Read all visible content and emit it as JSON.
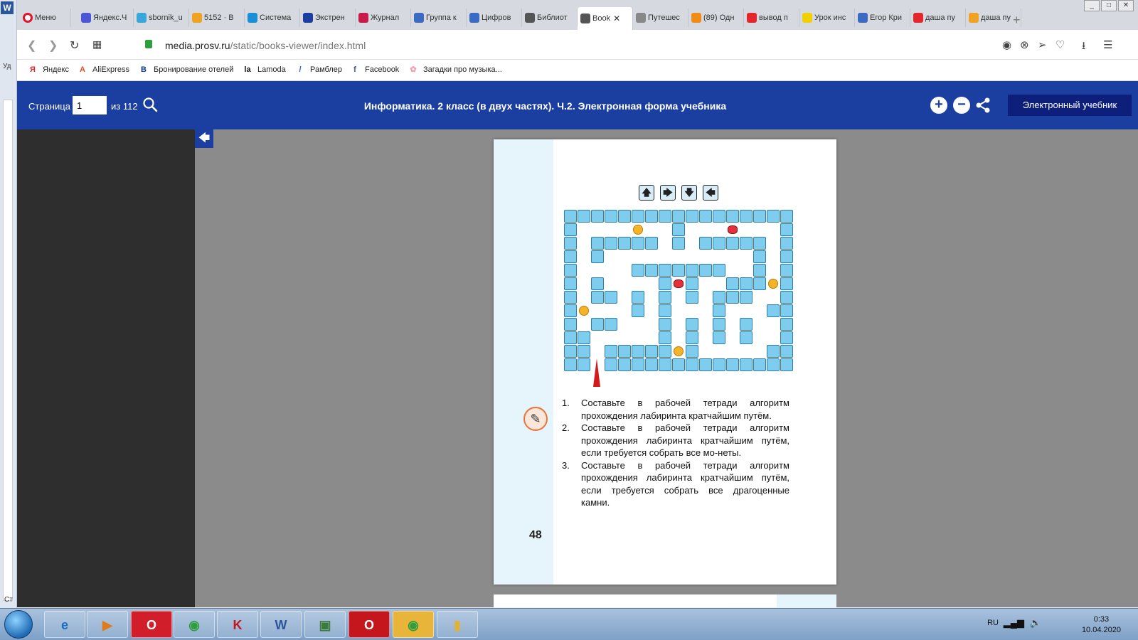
{
  "browser": {
    "menu_label": "Меню",
    "tabs": [
      {
        "label": "Яндекс.Ч",
        "color": "#4b57d6"
      },
      {
        "label": "sbornik_u",
        "color": "#3aa6d9"
      },
      {
        "label": "5152 · В",
        "color": "#f0a323"
      },
      {
        "label": "Система",
        "color": "#1a8fd6"
      },
      {
        "label": "Экстрен",
        "color": "#1b3fa0"
      },
      {
        "label": "Журнал",
        "color": "#c71c4a"
      },
      {
        "label": "Группа к",
        "color": "#3a6ac2"
      },
      {
        "label": "Цифров",
        "color": "#3a6ac2"
      },
      {
        "label": "Библиот",
        "color": "#555555"
      },
      {
        "label": "Book",
        "color": "#555555",
        "active": true
      },
      {
        "label": "Путешес",
        "color": "#888888"
      },
      {
        "label": "(89) Одн",
        "color": "#f28b16"
      },
      {
        "label": "вывод п",
        "color": "#e3262c"
      },
      {
        "label": "Урок инс",
        "color": "#f0d000"
      },
      {
        "label": "Егор Кри",
        "color": "#3a6ac2"
      },
      {
        "label": "даша пу",
        "color": "#e3262c"
      },
      {
        "label": "даша пу",
        "color": "#f0a323"
      }
    ],
    "tab_add": "+",
    "url_host": "media.prosv.ru",
    "url_path": "/static/books-viewer/index.html",
    "bookmarks": [
      {
        "label": "Яндекс",
        "icon": "Я",
        "color": "#e3262c"
      },
      {
        "label": "AliExpress",
        "icon": "A",
        "color": "#e8491d"
      },
      {
        "label": "Бронирование отелей",
        "icon": "B",
        "color": "#0c3b8a"
      },
      {
        "label": "Lamoda",
        "icon": "la",
        "color": "#111111"
      },
      {
        "label": "Рамблер",
        "icon": "/",
        "color": "#315efb"
      },
      {
        "label": "Facebook",
        "icon": "f",
        "color": "#3b5998"
      },
      {
        "label": "Загадки про музыка...",
        "icon": "✿",
        "color": "#f29bb0"
      }
    ]
  },
  "viewer": {
    "page_label": "Страница",
    "page_value": "1",
    "page_of": "из 112",
    "title": "Информатика. 2 класс (в двух частях). Ч.2. Электронная форма учебника",
    "zoom_in": "+",
    "zoom_out": "−",
    "ebook_button": "Электронный учебник"
  },
  "page": {
    "arrow_keys": [
      "🡅",
      "🡆",
      "🡇",
      "🡄"
    ],
    "tasks": [
      {
        "num": "1.",
        "text": "Составьте в рабочей тетради алгоритм прохождения лабиринта кратчайшим путём."
      },
      {
        "num": "2.",
        "text": "Составьте в рабочей тетради алгоритм прохождения лабиринта кратчайшим путём, если требуется собрать все мо-неты."
      },
      {
        "num": "3.",
        "text": "Составьте в рабочей тетради алгоритм прохождения лабиринта кратчайшим путём, если требуется собрать все драгоценные камни."
      }
    ],
    "page_number": "48"
  },
  "maze": {
    "rows": [
      "#################",
      "#.......#.......#",
      "#.#####.#.#####.#",
      "#.#...........#.#",
      "#....#######..#.#",
      "#.#....#.#..###.#",
      "#.##.#.#.#.###..#",
      "#....#.#...#...##",
      "#.##...#.#.#.#..#",
      "##.....#.#.#.#..#",
      "##.#####.#.....##",
      "##.##############"
    ],
    "coins": [
      [
        1,
        5
      ],
      [
        5,
        15
      ],
      [
        7,
        1
      ],
      [
        10,
        8
      ]
    ],
    "gems": [
      [
        1,
        12
      ],
      [
        5,
        8
      ]
    ]
  },
  "taskbar": {
    "lang": "RU",
    "time": "0:33",
    "date": "10.04.2020"
  },
  "word": {
    "logo": "W",
    "side_text": "Уд",
    "status_text": "Ст"
  }
}
